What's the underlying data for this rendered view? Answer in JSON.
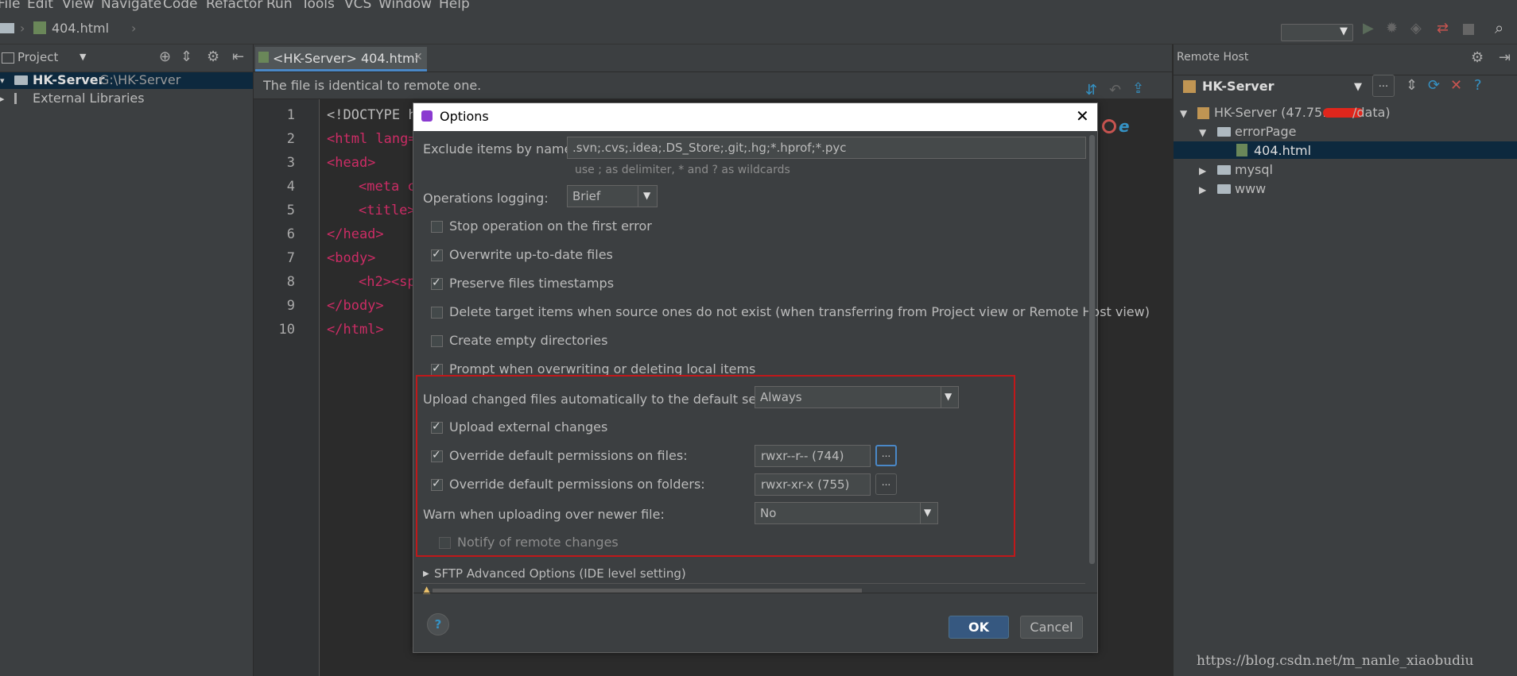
{
  "menu": [
    "File",
    "Edit",
    "View",
    "Navigate",
    "Code",
    "Refactor",
    "Run",
    "Tools",
    "VCS",
    "Window",
    "Help"
  ],
  "navbar": {
    "file_label": "404.html"
  },
  "project_panel": {
    "title": "Project",
    "items": [
      {
        "name": "HK-Server",
        "path": "G:\\HK-Server"
      },
      {
        "name": "External Libraries",
        "path": ""
      }
    ]
  },
  "editor": {
    "tab_label": "<HK-Server> 404.html",
    "notice": "The file is identical to remote one.",
    "line_numbers": [
      "1",
      "2",
      "3",
      "4",
      "5",
      "6",
      "7",
      "8",
      "9",
      "10"
    ],
    "lines": [
      "<!DOCTYPE h",
      "<html lang=",
      "<head>",
      "<meta c",
      "<title>",
      "</head>",
      "<body>",
      "<h2><sp",
      "</body>",
      "</html>"
    ]
  },
  "remote_host": {
    "panel_title": "Remote Host",
    "server_select": "HK-Server",
    "root_label": "HK-Server (47.75.",
    "root_suffix": "/data)",
    "tree": [
      {
        "label": "errorPage"
      },
      {
        "label": "404.html"
      },
      {
        "label": "mysql"
      },
      {
        "label": "www"
      }
    ]
  },
  "dialog": {
    "title": "Options",
    "exclude_label": "Exclude items by name:",
    "exclude_value": ".svn;.cvs;.idea;.DS_Store;.git;.hg;*.hprof;*.pyc",
    "exclude_hint": "use ; as delimiter, * and ? as wildcards",
    "logging_label": "Operations logging:",
    "logging_value": "Brief",
    "checkboxes": [
      {
        "label": "Stop operation on the first error",
        "checked": false
      },
      {
        "label": "Overwrite up-to-date files",
        "checked": true
      },
      {
        "label": "Preserve files timestamps",
        "checked": true
      },
      {
        "label": "Delete target items when source ones do not exist (when transferring from Project view or Remote Host view)",
        "checked": false
      },
      {
        "label": "Create empty directories",
        "checked": false
      },
      {
        "label": "Prompt when overwriting or deleting local items",
        "checked": true
      }
    ],
    "upload_label": "Upload changed files automatically to the default server",
    "upload_value": "Always",
    "upload_external": "Upload external changes",
    "perm_files_label": "Override default permissions on files:",
    "perm_files_value": "rwxr--r-- (744)",
    "perm_folders_label": "Override default permissions on folders:",
    "perm_folders_value": "rwxr-xr-x (755)",
    "warn_label": "Warn when uploading over newer file:",
    "warn_value": "No",
    "notify_label": "Notify of remote changes",
    "sftp_label": "SFTP Advanced Options (IDE level setting)",
    "ellipsis": "...",
    "ok": "OK",
    "cancel": "Cancel",
    "help": "?"
  },
  "watermark": "https://blog.csdn.net/m_nanle_xiaobudiu",
  "colors": {
    "accent": "#365880",
    "highlight_border": "#c0181a",
    "selection": "#0d293e"
  }
}
